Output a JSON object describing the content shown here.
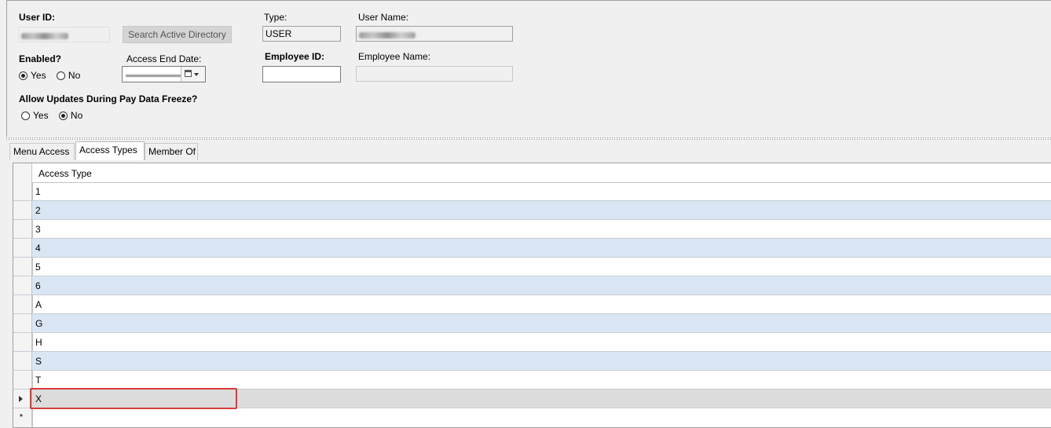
{
  "form": {
    "user_id_label": "User ID:",
    "search_ad_label": "Search Active Directory",
    "type_label": "Type:",
    "type_value": "USER",
    "user_name_label": "User Name:",
    "enabled_label": "Enabled?",
    "enabled_yes": "Yes",
    "enabled_no": "No",
    "enabled_selected": "Yes",
    "access_end_date_label": "Access End Date:",
    "employee_id_label": "Employee ID:",
    "employee_id_value": "",
    "employee_name_label": "Employee Name:",
    "employee_name_value": "",
    "freeze_label": "Allow Updates During Pay Data Freeze?",
    "freeze_yes": "Yes",
    "freeze_no": "No",
    "freeze_selected": "No"
  },
  "tabs": [
    {
      "label": "Menu Access",
      "active": false
    },
    {
      "label": "Access Types",
      "active": true
    },
    {
      "label": "Member Of",
      "active": false
    }
  ],
  "grid": {
    "column_header": "Access Type",
    "rows": [
      "1",
      "2",
      "3",
      "4",
      "5",
      "6",
      "A",
      "G",
      "H",
      "S",
      "T",
      "X"
    ],
    "selected_row": "X",
    "new_row_marker": "*"
  },
  "colors": {
    "alt_row": "#dae6f3",
    "selected_row": "#dcdcdc",
    "highlight_box": "#d83b3b"
  }
}
